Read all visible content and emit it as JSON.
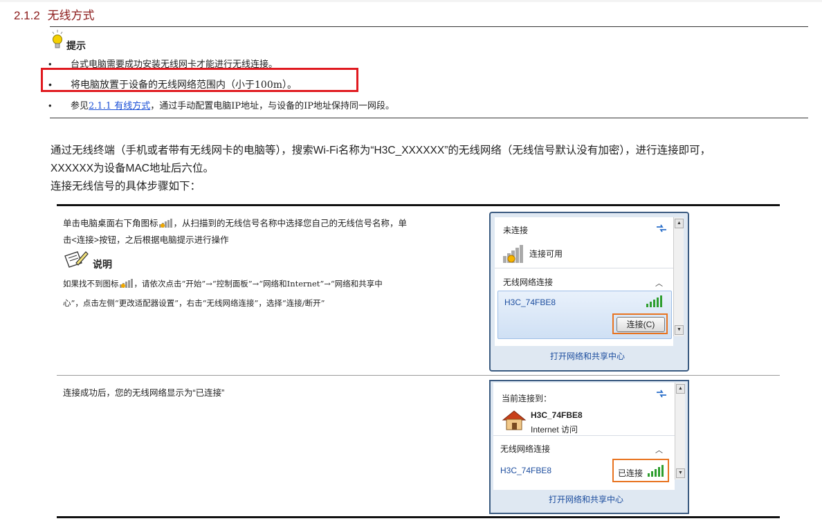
{
  "heading": {
    "number": "2.1.2",
    "title": "无线方式"
  },
  "tip": {
    "title": "提示",
    "bullets": [
      {
        "dot": "•",
        "text": "台式电脑需要成功安装无线网卡才能进行无线连接。"
      },
      {
        "dot": "•",
        "text": "将电脑放置于设备的无线网络范围内（小于100m）。"
      },
      {
        "dot": "•",
        "prefix": "参见",
        "link": "2.1.1  有线方式",
        "suffix": "，通过手动配置电脑IP地址，与设备的IP地址保持同一网段。"
      }
    ]
  },
  "intro": {
    "line1": "通过无线终端（手机或者带有无线网卡的电脑等），搜索Wi-Fi名称为“H3C_XXXXXX”的无线网络（无线信号默认没有加密），进行连接即可，",
    "line2": "XXXXXX为设备MAC地址后六位。",
    "line3": "连接无线信号的具体步骤如下："
  },
  "step1": {
    "line1a": "单击电脑桌面右下角图标",
    "line1b": "，从扫描到的无线信号名称中选择您自己的无线信号名称，单",
    "line2": "击<连接>按钮，之后根据电脑提示进行操作",
    "note_title": "说明",
    "note_line1a": "如果找不到图标",
    "note_line1b": "，请依次点击“开始”→“控制面板”→“网络和Internet”→“网络和共享中",
    "note_line2": "心”，点击左侧“更改适配器设置”，右击“无线网络连接”，选择“连接/断开”"
  },
  "step2": {
    "text": "连接成功后，您的无线网络显示为“已连接”"
  },
  "popup1": {
    "status": "未连接",
    "available": "连接可用",
    "section": "无线网络连接",
    "ssid": "H3C_74FBE8",
    "connect_button": "连接(C)",
    "footer_link": "打开网络和共享中心"
  },
  "popup2": {
    "current": "当前连接到：",
    "network_name": "H3C_74FBE8",
    "access": "Internet 访问",
    "section": "无线网络连接",
    "ssid": "H3C_74FBE8",
    "connected": "已连接",
    "footer_link": "打开网络和共享中心"
  },
  "colors": {
    "heading": "#8b1a1a",
    "highlight_box": "#e0191f",
    "link": "#1a4fd6",
    "orange_box": "#e8731f"
  }
}
